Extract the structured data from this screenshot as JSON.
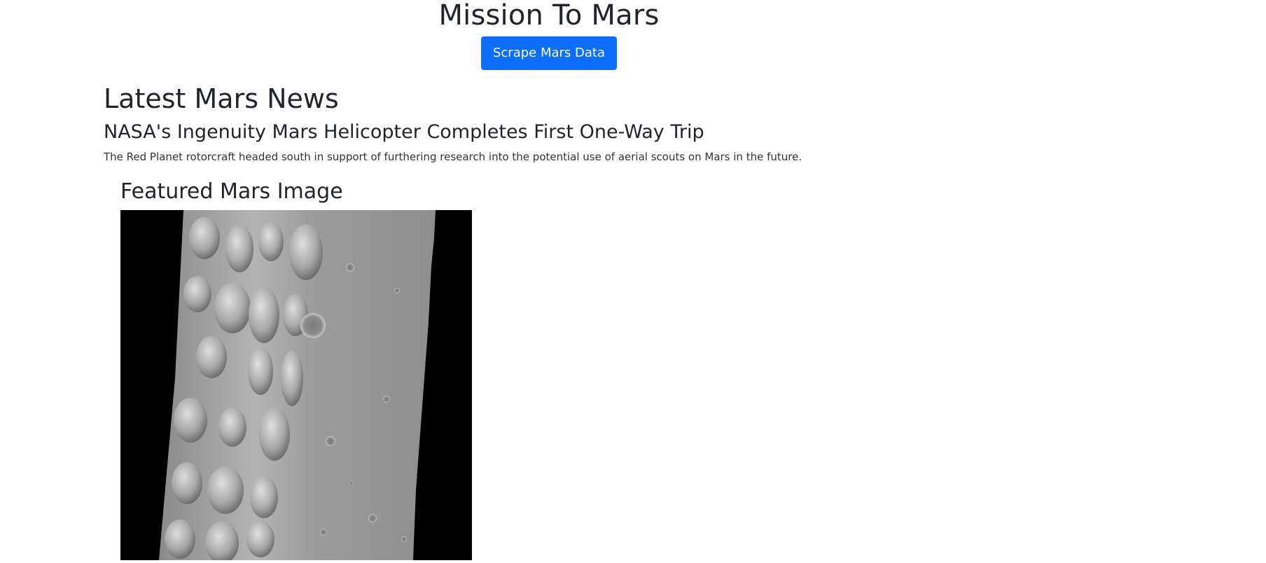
{
  "header": {
    "title": "Mission To Mars",
    "scrape_label": "Scrape Mars Data",
    "button_color": "#0d6efd"
  },
  "news": {
    "section_heading": "Latest Mars News",
    "title": "NASA's Ingenuity Mars Helicopter Completes First One-Way Trip",
    "paragraph": "The Red Planet rotorcraft headed south in support of furthering research into the potential use of aerial scouts on Mars in the future."
  },
  "featured": {
    "section_heading": "Featured Mars Image"
  }
}
